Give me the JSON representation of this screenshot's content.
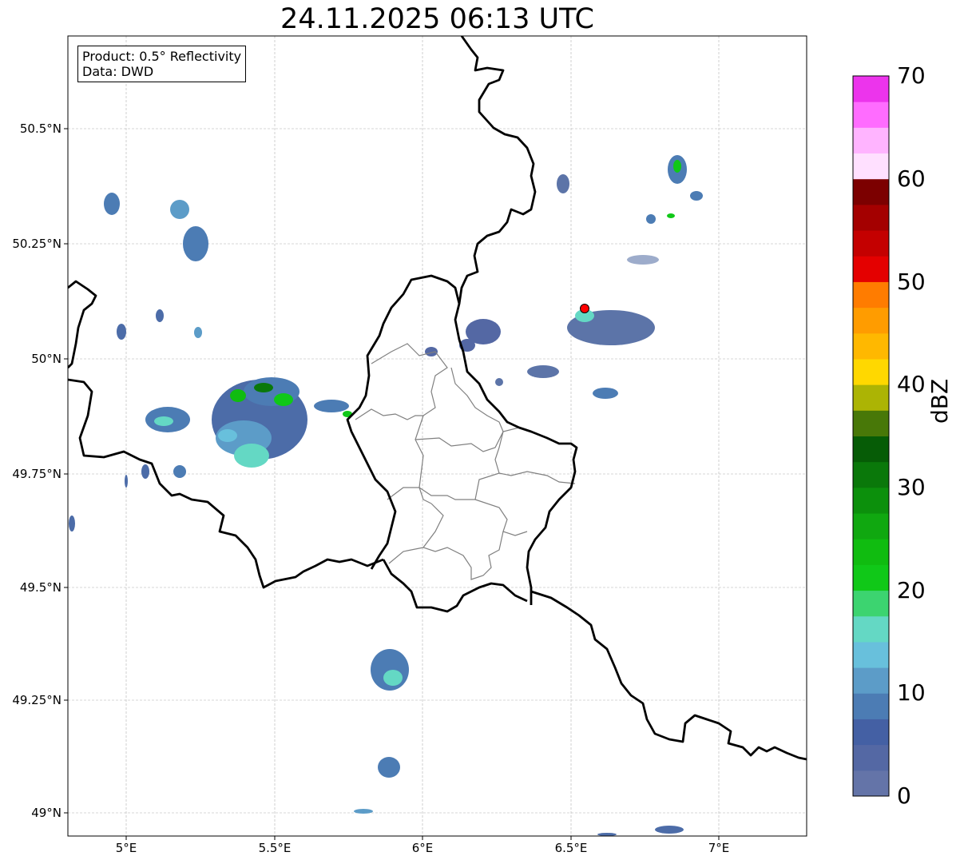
{
  "title": "24.11.2025 06:13 UTC",
  "info": {
    "product": "Product: 0.5° Reflectivity",
    "data": "Data: DWD"
  },
  "axes": {
    "lat_ticks": [
      "50.5°N",
      "50.25°N",
      "50°N",
      "49.75°N",
      "49.5°N",
      "49.25°N",
      "49°N"
    ],
    "lon_ticks": [
      "5°E",
      "5.5°E",
      "6°E",
      "6.5°E",
      "7°E"
    ]
  },
  "colorbar": {
    "label": "dBZ",
    "ticks": [
      "0",
      "10",
      "20",
      "30",
      "40",
      "50",
      "60",
      "70"
    ],
    "colors": [
      "#6474a8",
      "#5468a4",
      "#4460a4",
      "#4c7cb4",
      "#5c9cc8",
      "#68c0dc",
      "#64d8c4",
      "#3cd470",
      "#10c818",
      "#10bc10",
      "#10a810",
      "#0c900c",
      "#0a780a",
      "#065c06",
      "#487808",
      "#acb404",
      "#ffd800",
      "#ffb800",
      "#ff9c00",
      "#ff7c00",
      "#e40000",
      "#c40000",
      "#a40000",
      "#7c0000",
      "#ffe0ff",
      "#ffb4ff",
      "#ff6cff",
      "#ec34ec"
    ]
  },
  "colors": {
    "border": "#000000",
    "district": "#808080",
    "grid": "#b0b0b0",
    "radar_site": "#ff0000"
  }
}
